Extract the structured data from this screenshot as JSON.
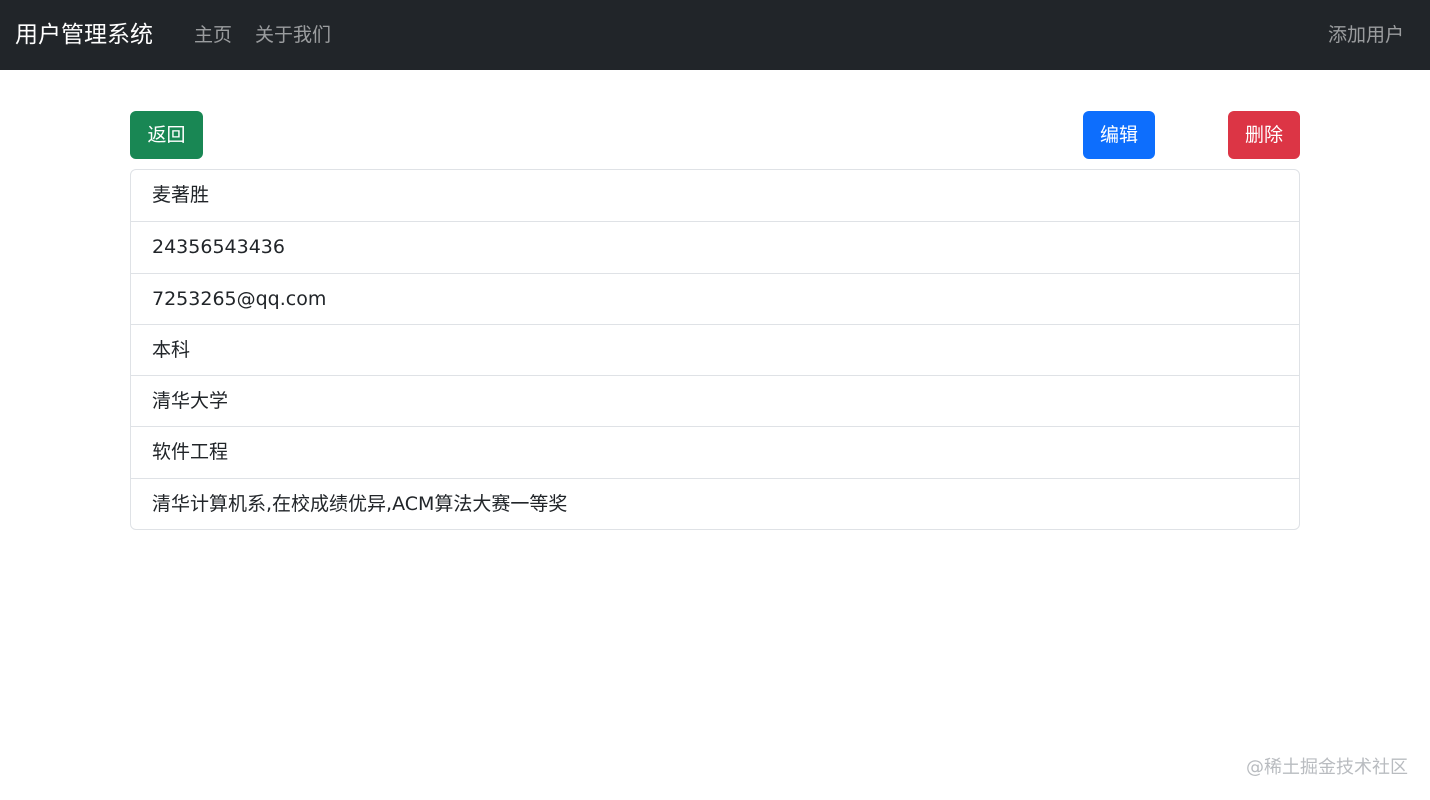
{
  "navbar": {
    "brand": "用户管理系统",
    "links": [
      "主页",
      "关于我们"
    ],
    "add_user": "添加用户"
  },
  "toolbar": {
    "back_label": "返回",
    "edit_label": "编辑",
    "delete_label": "删除"
  },
  "user_details": [
    "麦著胜",
    "24356543436",
    "7253265@qq.com",
    "本科",
    "清华大学",
    "软件工程",
    "清华计算机系,在校成绩优异,ACM算法大赛一等奖"
  ],
  "watermark": "@稀土掘金技术社区",
  "colors": {
    "navbar_bg": "#212529",
    "back_button": "#198754",
    "edit_button": "#0d6efd",
    "delete_button": "#dc3545"
  }
}
